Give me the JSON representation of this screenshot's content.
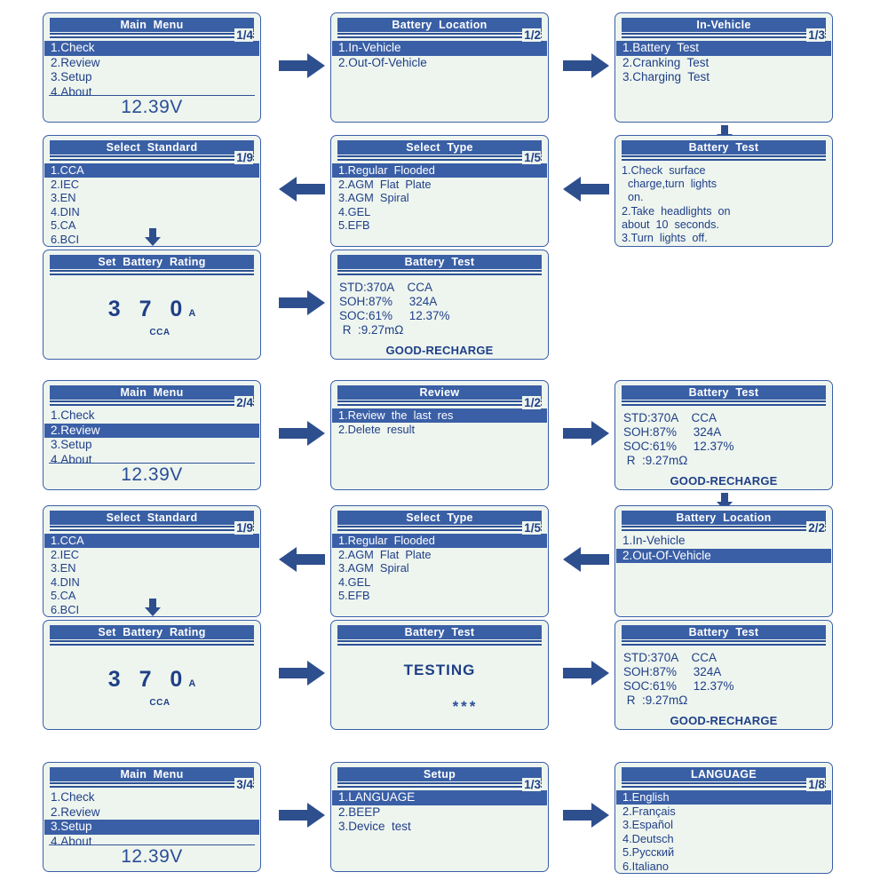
{
  "theme": {
    "lcd_bg": "#eef5ef",
    "border": "#3a5fa8",
    "title_bg": "#395fa5",
    "text": "#1f3f87",
    "highlight": "#3a5fa6",
    "arrow": "#2e4f8e"
  },
  "screens": {
    "main_menu_1": {
      "title": "Main  Menu",
      "pager": "1/4",
      "items": [
        "1.Check",
        "2.Review",
        "3.Setup",
        "4.About"
      ],
      "selected": 0,
      "voltage": "12.39V"
    },
    "battery_location_1": {
      "title": "Battery  Location",
      "pager": "1/2",
      "items": [
        "1.In-Vehicle",
        "2.Out-Of-Vehicle"
      ],
      "selected": 0
    },
    "in_vehicle": {
      "title": "In-Vehicle",
      "pager": "1/3",
      "items": [
        "1.Battery  Test",
        "2.Cranking  Test",
        "3.Charging  Test"
      ],
      "selected": 0
    },
    "battery_test_instructions": {
      "title": "Battery  Test",
      "lines": [
        "1.Check  surface",
        "  charge,turn  lights",
        "  on.",
        "2.Take  headlights  on",
        "about  10  seconds.",
        "3.Turn  lights  off."
      ]
    },
    "select_type_1": {
      "title": "Select  Type",
      "pager": "1/5",
      "items": [
        "1.Regular  Flooded",
        "2.AGM  Flat  Plate",
        "3.AGM  Spiral",
        "4.GEL",
        "5.EFB"
      ],
      "selected": 0
    },
    "select_standard_1": {
      "title": "Select  Standard",
      "pager": "1/9",
      "items": [
        "1.CCA",
        "2.IEC",
        "3.EN",
        "4.DIN",
        "5.CA",
        "6.BCI"
      ],
      "selected": 0
    },
    "set_rating_1": {
      "title": "Set  Battery  Rating",
      "value": "3 7 0",
      "unit": "A",
      "standard": "CCA"
    },
    "result_1": {
      "title": "Battery  Test",
      "lines": [
        "STD:370A    CCA",
        "SOH:87%     324A",
        "SOC:61%     12.37%",
        " R  :9.27mΩ"
      ],
      "verdict": "GOOD-RECHARGE"
    },
    "main_menu_2": {
      "title": "Main  Menu",
      "pager": "2/4",
      "items": [
        "1.Check",
        "2.Review",
        "3.Setup",
        "4.About"
      ],
      "selected": 1,
      "voltage": "12.39V"
    },
    "review": {
      "title": "Review",
      "pager": "1/2",
      "items": [
        "1.Review  the  last  res",
        "2.Delete  result"
      ],
      "selected": 0
    },
    "result_2": {
      "title": "Battery  Test",
      "lines": [
        "STD:370A    CCA",
        "SOH:87%     324A",
        "SOC:61%     12.37%",
        " R  :9.27mΩ"
      ],
      "verdict": "GOOD-RECHARGE"
    },
    "battery_location_2": {
      "title": "Battery  Location",
      "pager": "2/2",
      "items": [
        "1.In-Vehicle",
        "2.Out-Of-Vehicle"
      ],
      "selected": 1
    },
    "select_type_2": {
      "title": "Select  Type",
      "pager": "1/5",
      "items": [
        "1.Regular  Flooded",
        "2.AGM  Flat  Plate",
        "3.AGM  Spiral",
        "4.GEL",
        "5.EFB"
      ],
      "selected": 0
    },
    "select_standard_2": {
      "title": "Select  Standard",
      "pager": "1/9",
      "items": [
        "1.CCA",
        "2.IEC",
        "3.EN",
        "4.DIN",
        "5.CA",
        "6.BCI"
      ],
      "selected": 0
    },
    "set_rating_2": {
      "title": "Set  Battery  Rating",
      "value": "3 7 0",
      "unit": "A",
      "standard": "CCA"
    },
    "testing": {
      "title": "Battery  Test",
      "status": "TESTING",
      "dots": "***"
    },
    "result_3": {
      "title": "Battery  Test",
      "lines": [
        "STD:370A    CCA",
        "SOH:87%     324A",
        "SOC:61%     12.37%",
        " R  :9.27mΩ"
      ],
      "verdict": "GOOD-RECHARGE"
    },
    "main_menu_3": {
      "title": "Main  Menu",
      "pager": "3/4",
      "items": [
        "1.Check",
        "2.Review",
        "3.Setup",
        "4.About"
      ],
      "selected": 2,
      "voltage": "12.39V"
    },
    "setup": {
      "title": "Setup",
      "pager": "1/3",
      "items": [
        "1.LANGUAGE",
        "2.BEEP",
        "3.Device  test"
      ],
      "selected": 0
    },
    "language": {
      "title": "LANGUAGE",
      "pager": "1/8",
      "items": [
        "1.English",
        "2.Français",
        "3.Español",
        "4.Deutsch",
        "5.Русский",
        "6.Italiano"
      ],
      "selected": 0
    }
  },
  "arrows": [
    {
      "name": "arrow-main-to-location",
      "dir": "right"
    },
    {
      "name": "arrow-location-to-invehicle",
      "dir": "right"
    },
    {
      "name": "arrow-invehicle-to-instructions",
      "dir": "down"
    },
    {
      "name": "arrow-instructions-to-type",
      "dir": "left"
    },
    {
      "name": "arrow-type-to-standard",
      "dir": "left"
    },
    {
      "name": "arrow-standard-to-rating",
      "dir": "down"
    },
    {
      "name": "arrow-rating-to-result",
      "dir": "right"
    },
    {
      "name": "arrow-mainmenu2-to-review",
      "dir": "right"
    },
    {
      "name": "arrow-review-to-result",
      "dir": "right"
    },
    {
      "name": "arrow-result-to-location2",
      "dir": "down"
    },
    {
      "name": "arrow-location2-to-type2",
      "dir": "left"
    },
    {
      "name": "arrow-type2-to-standard2",
      "dir": "left"
    },
    {
      "name": "arrow-standard2-to-rating2",
      "dir": "down"
    },
    {
      "name": "arrow-rating2-to-testing",
      "dir": "right"
    },
    {
      "name": "arrow-testing-to-result3",
      "dir": "right"
    },
    {
      "name": "arrow-mainmenu3-to-setup",
      "dir": "right"
    },
    {
      "name": "arrow-setup-to-language",
      "dir": "right"
    }
  ]
}
